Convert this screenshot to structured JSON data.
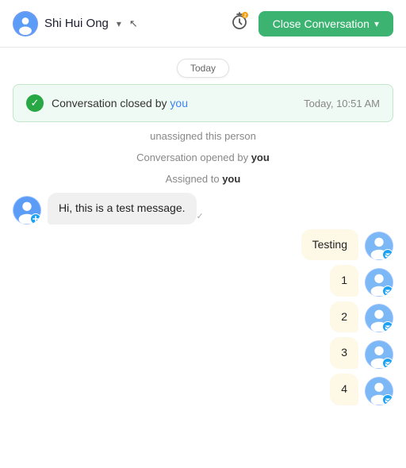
{
  "header": {
    "contact_name": "Shi Hui Ong",
    "close_btn_label": "Close Conversation",
    "caret": "▾"
  },
  "date_divider": "Today",
  "closed_notice": {
    "text_prefix": "Conversation closed by ",
    "you_text": "you",
    "timestamp": "Today, 10:51 AM"
  },
  "activity": [
    {
      "text": "unassigned this person"
    },
    {
      "text": "Conversation opened by ",
      "strong": "you"
    },
    {
      "text": "Assigned to ",
      "strong": "you"
    }
  ],
  "messages": [
    {
      "type": "incoming",
      "text": "Hi, this is a test message.",
      "show_check": true
    },
    {
      "type": "outgoing",
      "text": "Testing"
    },
    {
      "type": "outgoing",
      "text": "1"
    },
    {
      "type": "outgoing",
      "text": "2"
    },
    {
      "type": "outgoing",
      "text": "3"
    },
    {
      "type": "outgoing",
      "text": "4"
    }
  ]
}
